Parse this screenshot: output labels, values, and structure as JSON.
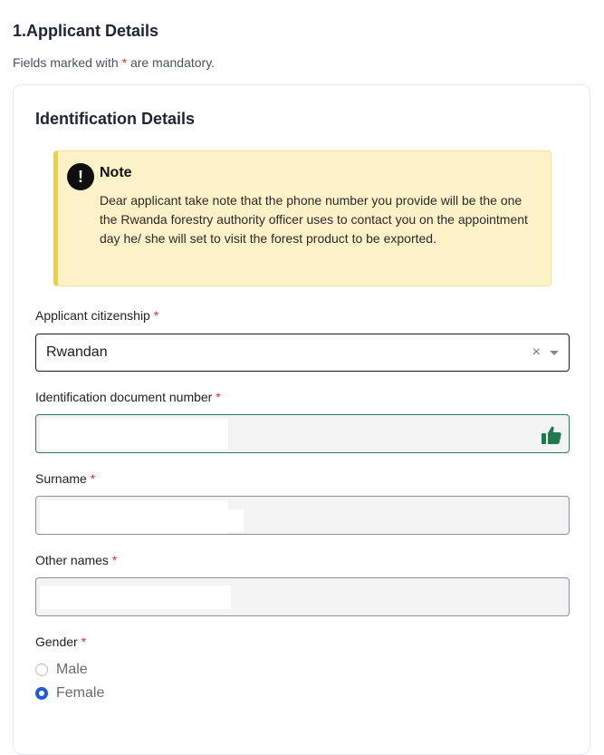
{
  "section": {
    "title": "1.Applicant Details",
    "mandatory_prefix": "Fields marked with",
    "mandatory_star": "*",
    "mandatory_suffix": "are mandatory."
  },
  "card": {
    "title": "Identification Details",
    "note": {
      "icon": "exclamation-icon",
      "icon_glyph": "!",
      "title": "Note",
      "text": "Dear applicant take note that the phone number you provide will be the one the Rwanda forestry authority officer uses to contact you on the appointment day he/ she will set to visit the forest product to be exported."
    },
    "fields": {
      "citizenship": {
        "label": "Applicant citizenship",
        "required_mark": "*",
        "value": "Rwandan",
        "clear_glyph": "×"
      },
      "id_number": {
        "label": "Identification document number",
        "required_mark": "*",
        "value": "",
        "status_icon": "thumbs-up-icon",
        "status_color": "#1f7a4d"
      },
      "surname": {
        "label": "Surname",
        "required_mark": "*",
        "value": ""
      },
      "other_names": {
        "label": "Other names",
        "required_mark": "*",
        "value": ""
      },
      "gender": {
        "label": "Gender",
        "required_mark": "*",
        "options": [
          {
            "label": "Male",
            "checked": false
          },
          {
            "label": "Female",
            "checked": true
          }
        ]
      }
    }
  },
  "colors": {
    "required": "#e0312b",
    "note_background": "#fdf1c8",
    "note_accent": "#f5cf3a",
    "radio_selected": "#1d5be0",
    "valid_border": "#2f7d55"
  }
}
